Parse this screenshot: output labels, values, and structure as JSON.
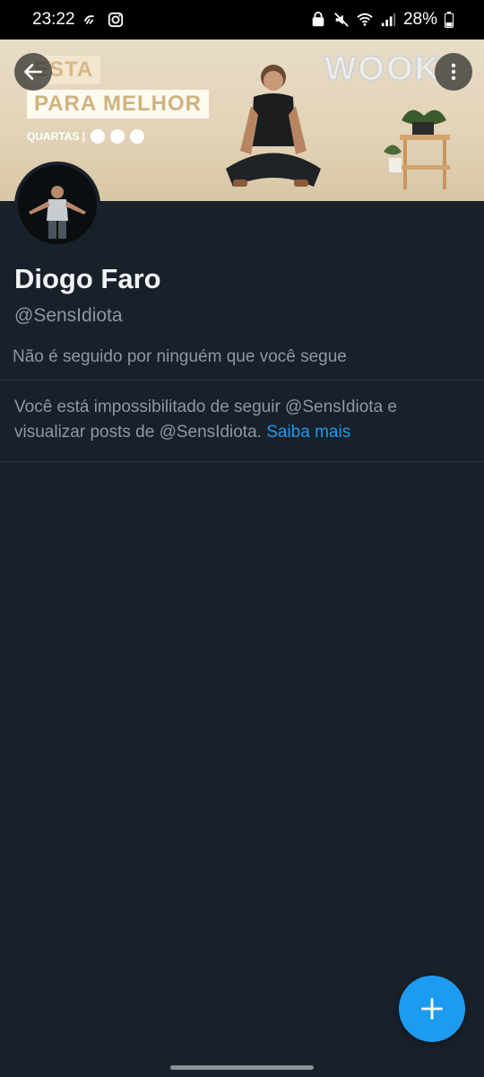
{
  "status_bar": {
    "time": "23:22",
    "battery": "28%",
    "icons": [
      "weather-icon",
      "instagram-icon",
      "lock-icon",
      "mute-icon",
      "wifi-icon",
      "signal-icon",
      "battery-icon"
    ]
  },
  "banner": {
    "title_line1": "ESTA",
    "title_line2": "PARA MELHOR",
    "subtitle": "QUARTAS |",
    "logo_text": "WOOK"
  },
  "profile": {
    "name": "Diogo Faro",
    "handle": "@SensIdiota",
    "followers_note": "Não é seguido por ninguém que você segue",
    "blocked_message": "Você está impossibilitado de seguir @SensIdiota e visualizar posts de @SensIdiota.",
    "learn_more": "Saiba mais"
  },
  "colors": {
    "background": "#18202a",
    "accent": "#1d9bf0",
    "muted_text": "#8b98a5"
  }
}
